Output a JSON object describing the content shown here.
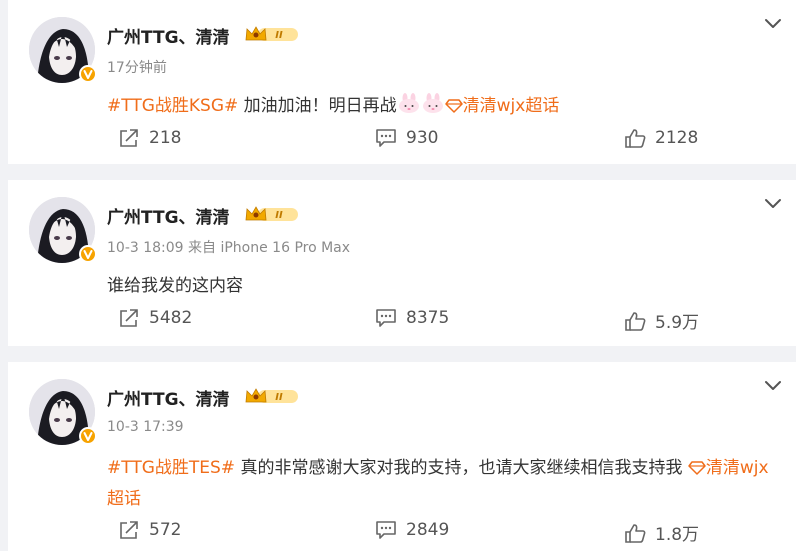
{
  "posts": [
    {
      "author": "广州TTG、清清",
      "meta": "17分钟前",
      "hashtag": "#TTG战胜KSG#",
      "text": " 加油加油！明日再战",
      "super_topic": "清清wjx超话",
      "shares": "218",
      "comments": "930",
      "likes": "2128"
    },
    {
      "author": "广州TTG、清清",
      "meta": "10-3 18:09 来自 iPhone 16 Pro Max",
      "text": "谁给我发的这内容",
      "shares": "5482",
      "comments": "8375",
      "likes": "5.9万"
    },
    {
      "author": "广州TTG、清清",
      "meta": "10-3 17:39",
      "hashtag": "#TTG战胜TES#",
      "text": " 真的非常感谢大家对我的支持，也请大家继续相信我支持我 ",
      "super_topic": "清清wjx超话",
      "shares": "572",
      "comments": "2849",
      "likes": "1.8万"
    }
  ],
  "icons": {
    "more": "chevron-down-icon",
    "share": "share-icon",
    "comment": "comment-icon",
    "like": "thumbs-up-icon",
    "verified": "verified-badge-icon",
    "vip": "crown-badge-icon",
    "super_topic": "diamond-icon"
  },
  "colors": {
    "accent": "#f06d1a",
    "verified": "#f7a300",
    "background": "#f1f2f5"
  }
}
